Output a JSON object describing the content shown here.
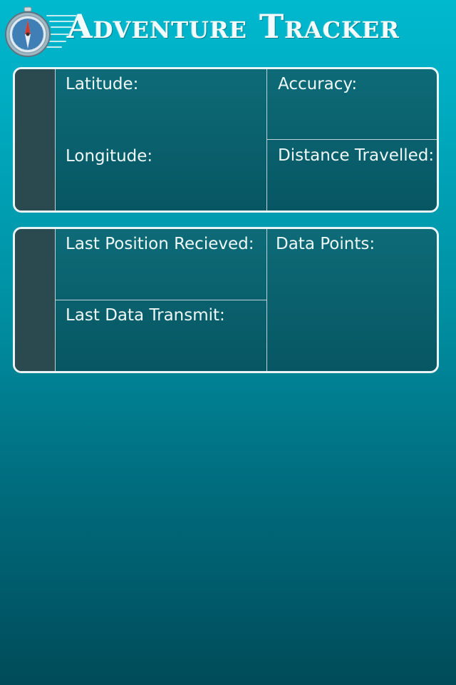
{
  "header": {
    "title": "Adventure Tracker",
    "logo_icon": "compass-icon"
  },
  "location_panel": {
    "latitude_label": "Latitude:",
    "longitude_label": "Longitude:",
    "accuracy_label": "Accuracy:",
    "distance_label": "Distance Travelled:"
  },
  "status_panel": {
    "last_position_label": "Last Position Recieved:",
    "last_transmit_label": "Last Data Transmit:",
    "data_points_label": "Data Points:"
  },
  "colors": {
    "background_top": "#00b9cf",
    "background_bottom": "#004b59",
    "panel_fill": "#0d6b77",
    "panel_border": "#e9f2f4",
    "side_strip": "#2b4a50"
  }
}
